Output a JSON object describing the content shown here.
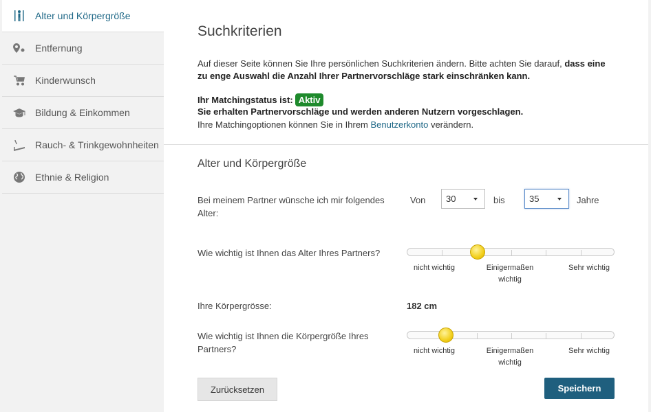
{
  "sidebar": {
    "items": [
      {
        "label": "Alter und Körpergröße",
        "icon": "height-icon",
        "active": true
      },
      {
        "label": "Entfernung",
        "icon": "location-pin-icon"
      },
      {
        "label": "Kinderwunsch",
        "icon": "stroller-icon"
      },
      {
        "label": "Bildung & Einkommen",
        "icon": "graduation-cap-icon"
      },
      {
        "label": "Rauch- & Trinkgewohnheiten",
        "icon": "cigarette-icon"
      },
      {
        "label": "Ethnie & Religion",
        "icon": "globe-icon"
      }
    ]
  },
  "main": {
    "title": "Suchkriterien",
    "intro_plain": "Auf dieser Seite können Sie Ihre persönlichen Suchkriterien ändern. Bitte achten Sie darauf, ",
    "intro_bold": "dass eine zu enge Auswahl die Anzahl Ihrer Partnervorschläge stark einschränken kann.",
    "matching_label": "Ihr Matchingstatus ist:",
    "matching_badge": "Aktiv",
    "matching_line2": "Sie erhalten Partnervorschläge und werden anderen Nutzern vorgeschlagen.",
    "matching_line3_pre": "Ihre Matchingoptionen können Sie in Ihrem ",
    "matching_line3_link": "Benutzerkonto",
    "matching_line3_post": " verändern.",
    "section_title": "Alter und Körpergröße",
    "age": {
      "label": "Bei meinem Partner wünsche ich mir folgendes Alter:",
      "from_label": "Von",
      "from_value": "30",
      "to_label": "bis",
      "to_value": "35",
      "unit": "Jahre"
    },
    "age_importance": {
      "label": "Wie wichtig ist Ihnen das Alter Ihres Partners?",
      "value": 0.34,
      "scale": [
        "nicht wichtig",
        "Einigermaßen wichtig",
        "Sehr wichtig"
      ]
    },
    "height": {
      "label": "Ihre Körpergrösse:",
      "value": "182 cm"
    },
    "height_importance": {
      "label": "Wie wichtig ist Ihnen die Körpergröße Ihres Partners?",
      "value": 0.19,
      "scale": [
        "nicht wichtig",
        "Einigermaßen wichtig",
        "Sehr wichtig"
      ]
    },
    "reset_label": "Zurücksetzen",
    "save_label": "Speichern"
  },
  "colors": {
    "accent": "#1f6887",
    "save_button": "#1f5f7e",
    "badge": "#1e8a2c",
    "thumb": "#f2cf1c"
  }
}
